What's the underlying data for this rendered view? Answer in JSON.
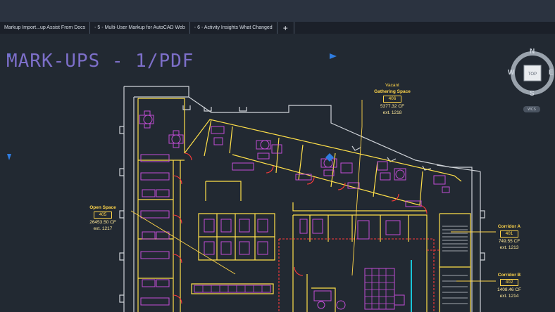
{
  "tabs": [
    {
      "label": "Markup Import...up Assist From Docs"
    },
    {
      "label": "- 5 - Multi-User Markup for AutoCAD Web"
    },
    {
      "label": "- 6 - Activity Insights What Changed"
    }
  ],
  "tab_add_label": "+",
  "drawing_title": "MARK-UPS - 1/PDF",
  "viewcube": {
    "top": "TOP",
    "north": "N",
    "south": "S",
    "east": "E",
    "west": "W",
    "wcs": "WCS"
  },
  "rooms": {
    "vacant_status": "Vacant",
    "gathering": {
      "name": "Gathering Space",
      "number": "406",
      "area": "5377.32 CF",
      "ext": "ext. 1218"
    },
    "open_space": {
      "name": "Open Space",
      "number": "405",
      "area": "26453.50 CF",
      "ext": "ext. 1217"
    },
    "corridor_a": {
      "name": "Corridor A",
      "number": "401",
      "area": "749.55 CF",
      "ext": "ext. 1213"
    },
    "corridor_b": {
      "name": "Corridor B",
      "number": "402",
      "area": "1408.46 CF",
      "ext": "ext. 1214"
    }
  },
  "colors": {
    "title": "#7d6fc9",
    "walls": "#ffe04a",
    "furniture": "#c24dd6",
    "doors": "#ff3b3b",
    "outline": "#cfd3d8",
    "label": "#ffd54a",
    "marker": "#2f7de1"
  }
}
